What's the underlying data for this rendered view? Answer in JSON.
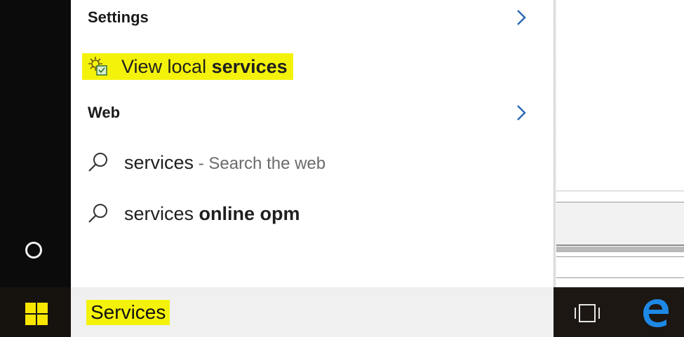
{
  "results": {
    "settings_header": "Settings",
    "settings_item": {
      "prefix": "View local ",
      "bold": "services",
      "icon": "services-gear-icon"
    },
    "web_header": "Web",
    "web_items": [
      {
        "text": "services",
        "suffix": " - Search the web",
        "icon": "search-icon"
      },
      {
        "text": "services ",
        "bold": "online opm",
        "icon": "search-icon"
      }
    ]
  },
  "search": {
    "query": "Services"
  },
  "colors": {
    "highlight": "#f4f20a",
    "accent": "#2b6ab3",
    "windows_logo": "#f7e600"
  }
}
